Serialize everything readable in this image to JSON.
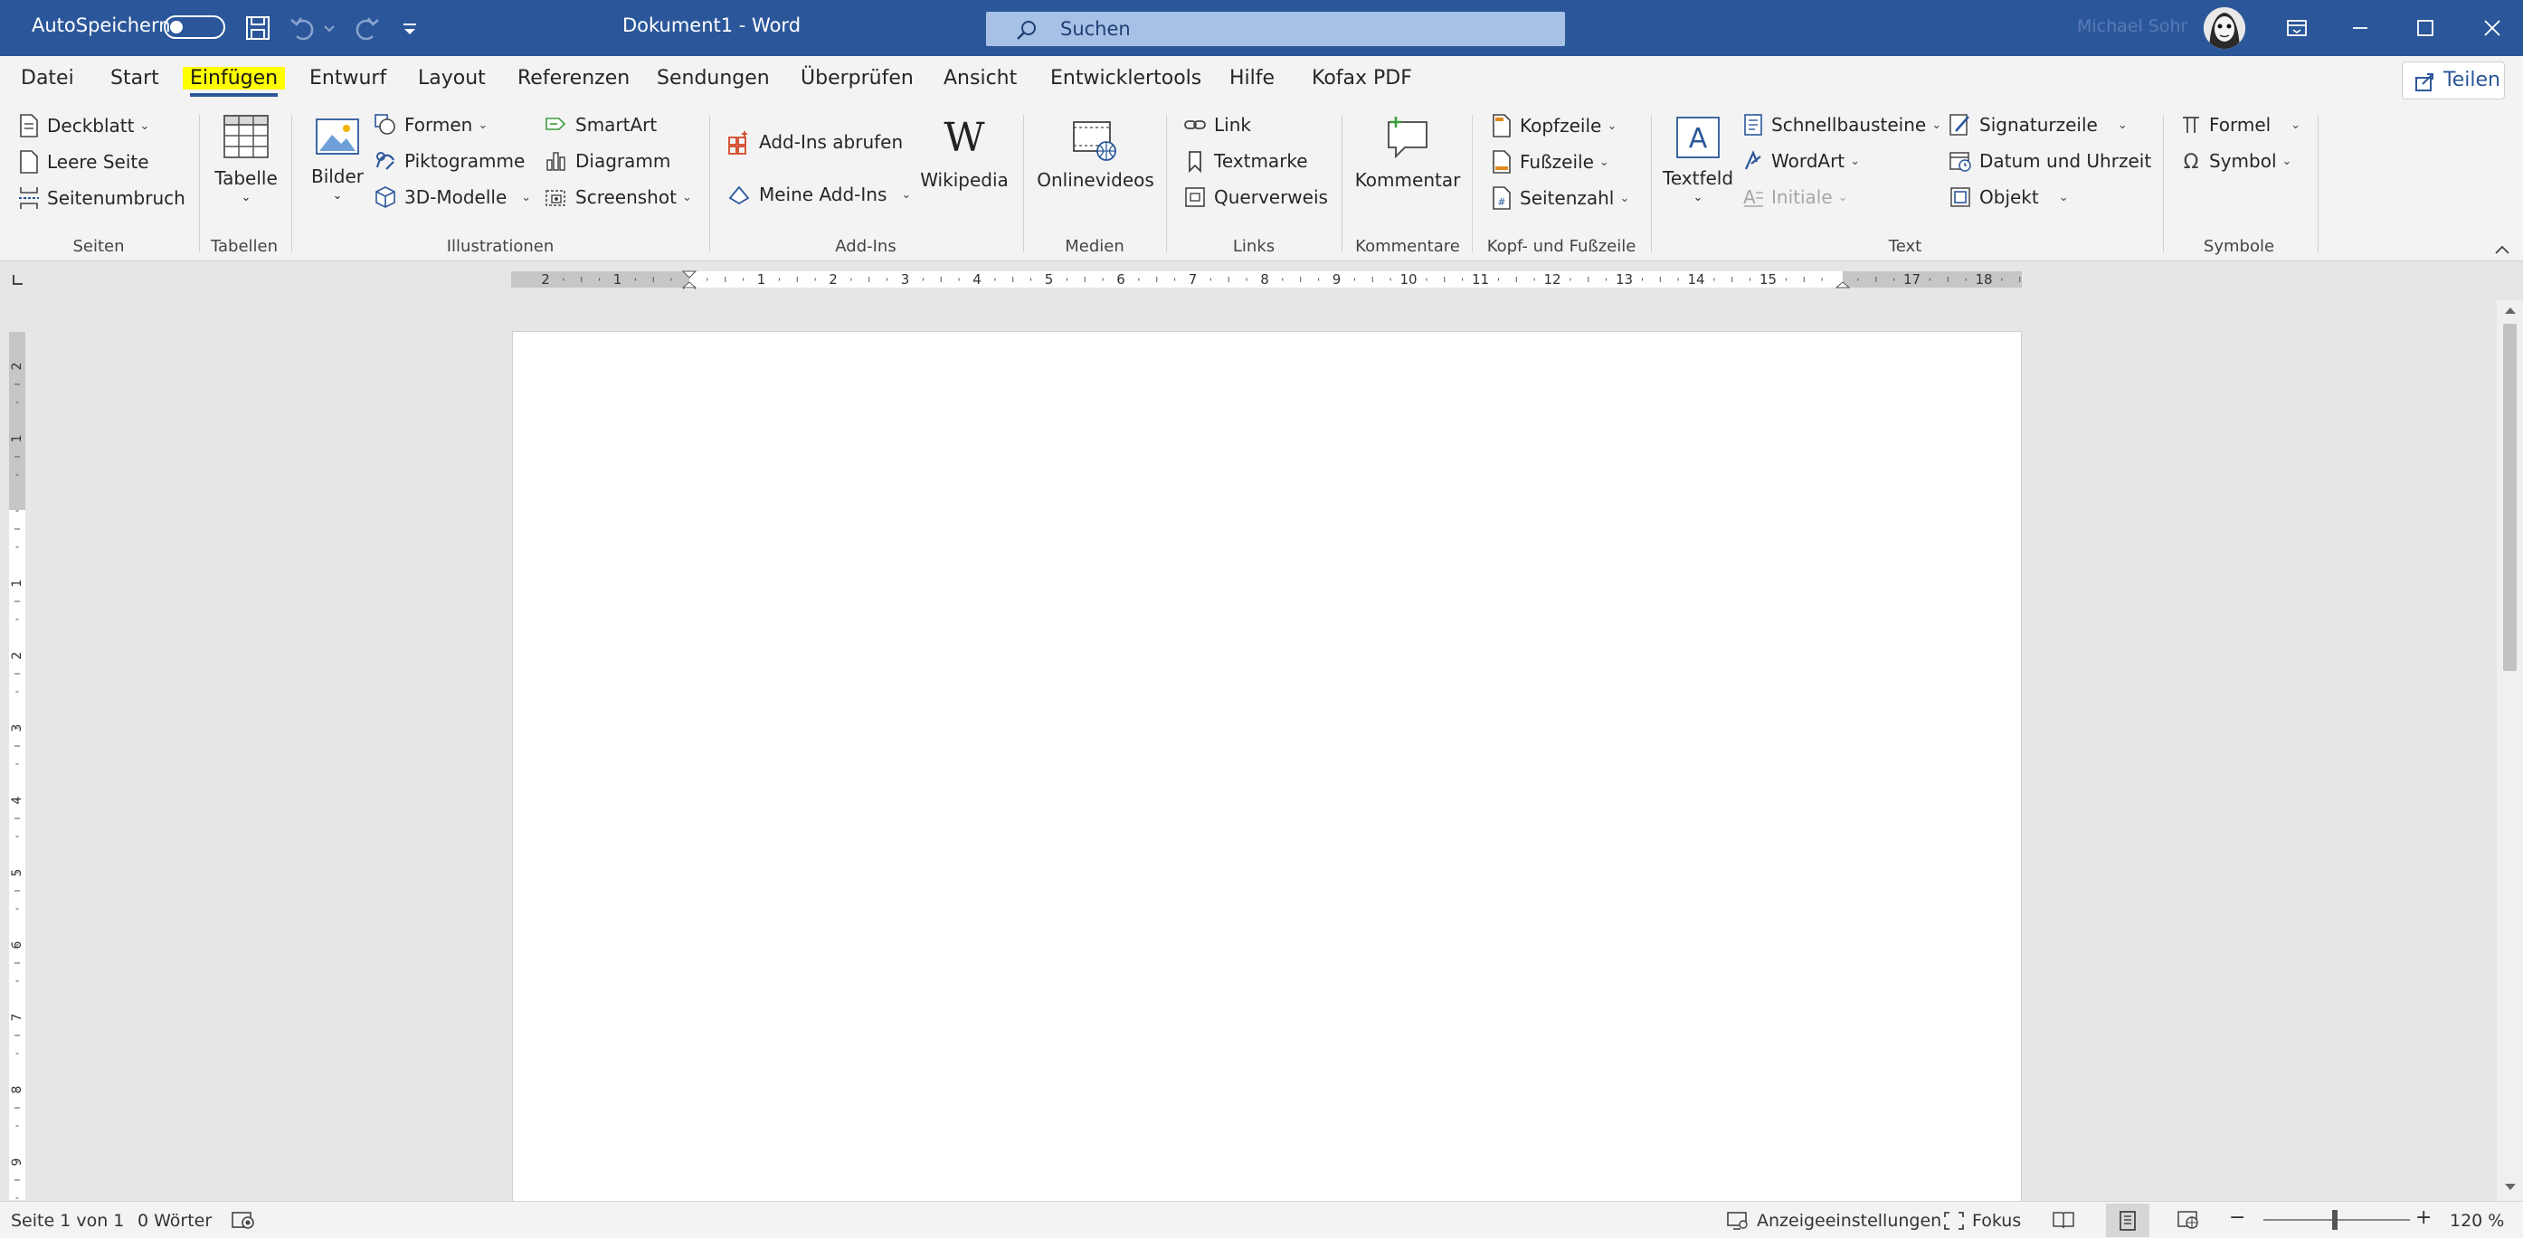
{
  "titlebar": {
    "autosave_label": "AutoSpeichern",
    "document_title": "Dokument1  -  Word",
    "search_placeholder": "Suchen",
    "user_name": "Michael Sohr"
  },
  "menu": {
    "tabs": [
      {
        "label": "Datei"
      },
      {
        "label": "Start"
      },
      {
        "label": "Einfügen"
      },
      {
        "label": "Entwurf"
      },
      {
        "label": "Layout"
      },
      {
        "label": "Referenzen"
      },
      {
        "label": "Sendungen"
      },
      {
        "label": "Überprüfen"
      },
      {
        "label": "Ansicht"
      },
      {
        "label": "Entwicklertools"
      },
      {
        "label": "Hilfe"
      },
      {
        "label": "Kofax PDF"
      }
    ],
    "active_tab": "Einfügen",
    "share_label": "Teilen"
  },
  "ribbon": {
    "seiten": {
      "label": "Seiten",
      "deckblatt": "Deckblatt",
      "leere_seite": "Leere Seite",
      "seitenumbruch": "Seitenumbruch"
    },
    "tabellen": {
      "label": "Tabellen",
      "tabelle": "Tabelle"
    },
    "illustrationen": {
      "label": "Illustrationen",
      "bilder": "Bilder",
      "formen": "Formen",
      "piktogramme": "Piktogramme",
      "modelle": "3D-Modelle",
      "smartart": "SmartArt",
      "diagramm": "Diagramm",
      "screenshot": "Screenshot"
    },
    "addins": {
      "label": "Add-Ins",
      "abrufen": "Add-Ins abrufen",
      "meine": "Meine Add-Ins",
      "wikipedia": "Wikipedia"
    },
    "medien": {
      "label": "Medien",
      "onlinevideos": "Onlinevideos"
    },
    "links": {
      "label": "Links",
      "link": "Link",
      "textmarke": "Textmarke",
      "querverweis": "Querverweis"
    },
    "kommentare": {
      "label": "Kommentare",
      "kommentar": "Kommentar"
    },
    "kopf": {
      "label": "Kopf- und Fußzeile",
      "kopfzeile": "Kopfzeile",
      "fusszeile": "Fußzeile",
      "seitenzahl": "Seitenzahl"
    },
    "text": {
      "label": "Text",
      "textfeld": "Textfeld",
      "schnellbausteine": "Schnellbausteine",
      "wordart": "WordArt",
      "initiale": "Initiale",
      "signaturzeile": "Signaturzeile",
      "datum": "Datum und Uhrzeit",
      "objekt": "Objekt"
    },
    "symbole": {
      "label": "Symbole",
      "formel": "Formel",
      "symbol": "Symbol"
    }
  },
  "ruler": {
    "horizontal_ticks": [
      "2",
      "1",
      "1",
      "2",
      "3",
      "4",
      "5",
      "6",
      "7",
      "8",
      "9",
      "10",
      "11",
      "12",
      "13",
      "14",
      "15",
      "17",
      "18"
    ],
    "vertical_ticks": [
      "2",
      "1",
      "1",
      "2",
      "3",
      "4",
      "5",
      "6",
      "7",
      "8",
      "9"
    ]
  },
  "status": {
    "page": "Seite 1 von 1",
    "words": "0 Wörter",
    "display_settings": "Anzeigeeinstellungen",
    "focus": "Fokus",
    "zoom": "120 %"
  },
  "colors": {
    "titlebar": "#2b579a",
    "highlight": "#ffff00",
    "ribbon": "#f3f3f3",
    "canvas": "#e6e6e6"
  }
}
